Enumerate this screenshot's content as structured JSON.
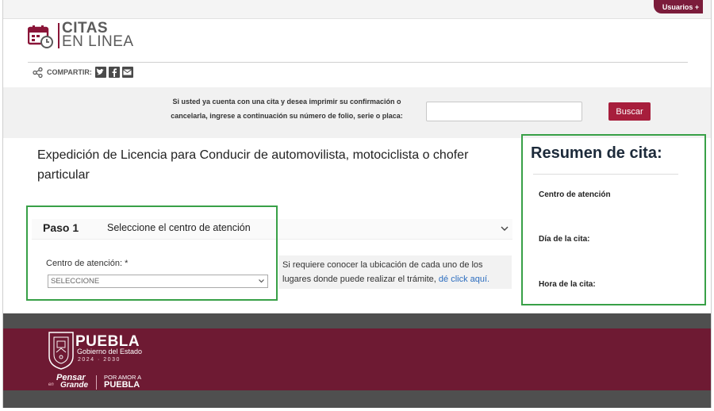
{
  "topbar": {
    "users_label": "Usuarios +"
  },
  "logo": {
    "line1": "CITAS",
    "line2": "EN LINEA"
  },
  "share": {
    "label": "COMPARTIR:",
    "icons": [
      "twitter-icon",
      "facebook-icon",
      "email-icon"
    ]
  },
  "search": {
    "prompt_line1": "Si usted ya cuenta con una cita y desea imprimir su confirmación o",
    "prompt_line2": "cancelarla, ingrese a continuación su número de folio, serie o placa:",
    "input_value": "",
    "button_label": "Buscar"
  },
  "main": {
    "title_line1": "Expedición de Licencia para Conducir de automovilista, motociclista o chofer",
    "title_line2": "particular",
    "step": {
      "number_label": "Paso 1",
      "description": "Seleccione el centro de atención",
      "field_label": "Centro de atención: *",
      "select_value": "SELECCIONE",
      "info_line1": "Si requiere conocer la ubicación de cada uno de los",
      "info_line2": "lugares donde puede realizar el trámite,",
      "info_link": "dé click aquí."
    }
  },
  "resumen": {
    "title": "Resumen de cita:",
    "centro_label": "Centro de atención",
    "dia_label": "Día de la cita:",
    "hora_label": "Hora de la cita:"
  },
  "footer": {
    "brand": "PUEBLA",
    "gobierno": "Gobierno del Estado",
    "years": "2024 · 2030",
    "pensar": "Pensar",
    "en": "en",
    "grande": "Grande",
    "por_amor": "POR AMOR A",
    "puebla": "PUEBLA"
  },
  "colors": {
    "brand_maroon": "#6e1a33",
    "button_red": "#a71e3c",
    "highlight_green": "#38a047",
    "footer_gray": "#4f4f4f",
    "link_blue": "#2c6dbf"
  }
}
